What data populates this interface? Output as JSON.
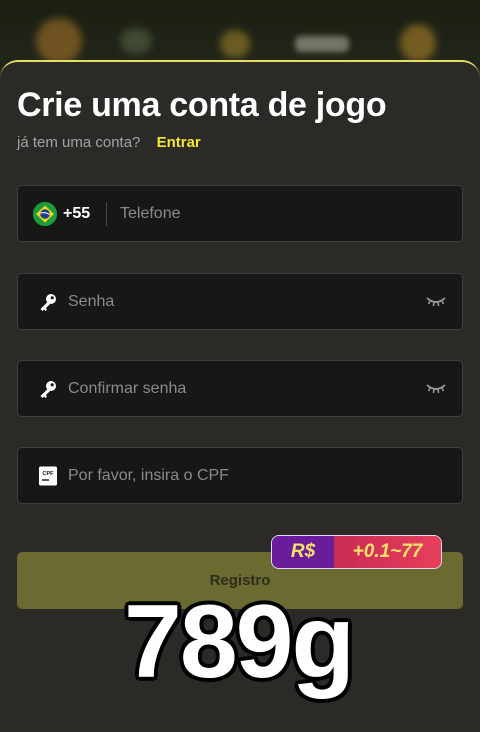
{
  "title": "Crie uma conta de jogo",
  "login_prompt": {
    "question": "já tem uma conta?",
    "link": "Entrar"
  },
  "phone_field": {
    "flag": "brazil-flag-icon",
    "country_code": "+55",
    "placeholder": "Telefone"
  },
  "password_field": {
    "icon": "key-icon",
    "placeholder": "Senha",
    "toggle_icon": "eye-closed-icon"
  },
  "confirm_password_field": {
    "icon": "key-icon",
    "placeholder": "Confirmar senha",
    "toggle_icon": "eye-closed-icon"
  },
  "cpf_field": {
    "icon": "cpf-card-icon",
    "icon_text": "CPF",
    "placeholder": "Por favor, insira o CPF"
  },
  "register_button": {
    "label": "Registro"
  },
  "bonus_badge": {
    "currency": "R$",
    "amount": "+0.1~77"
  },
  "overlay_brand": "789g",
  "colors": {
    "accent": "#f5e63a",
    "button": "#6b6a31",
    "badge_left": "#6a1d9a",
    "badge_right": "#e63f5b"
  }
}
